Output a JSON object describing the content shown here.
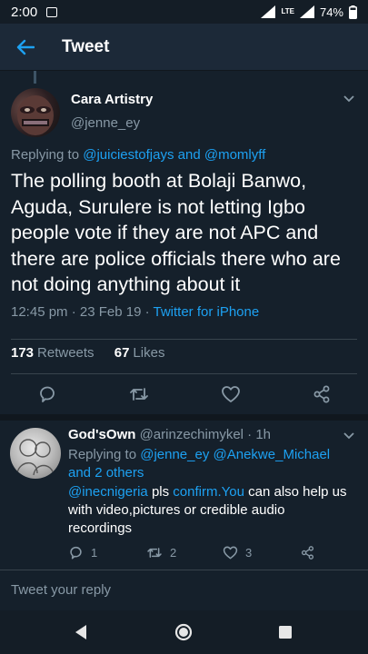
{
  "status_bar": {
    "time": "2:00",
    "network": "LTE",
    "battery": "74%"
  },
  "app_bar": {
    "title": "Tweet"
  },
  "tweet": {
    "author_name": "Cara Artistry",
    "author_handle": "@jenne_ey",
    "replying_prefix": "Replying to",
    "replying_user1": "@juiciestofjays",
    "replying_and": "and",
    "replying_user2": "@momlyff",
    "text": "The polling booth at Bolaji Banwo, Aguda, Surulere is not letting Igbo people vote if they are not APC and there are police officials there who are not doing anything about it",
    "timestamp": "12:45 pm · 23 Feb 19 · ",
    "source": "Twitter for iPhone",
    "retweets_count": "173",
    "retweets_label": "Retweets",
    "likes_count": "67",
    "likes_label": "Likes"
  },
  "reply": {
    "author_name": "God'sOwn",
    "author_handle": "@arinzechimykel · 1h",
    "replying_prefix": "Replying to",
    "replying_user1": "@jenne_ey",
    "replying_user2": "@Anekwe_Michael",
    "replying_others": "and 2 others",
    "mention": "@inecnigeria",
    "text_part1": " pls ",
    "link_text": "confirm.You",
    "text_part2": " can also help us with video,pictures or credible audio recordings",
    "reply_count": "1",
    "retweet_count": "2",
    "like_count": "3"
  },
  "compose": {
    "placeholder": "Tweet your reply"
  },
  "colors": {
    "background": "#15202b",
    "appbar": "#1c2938",
    "accent": "#1da1f2",
    "secondary_text": "#8899a6",
    "divider": "#38444d"
  }
}
